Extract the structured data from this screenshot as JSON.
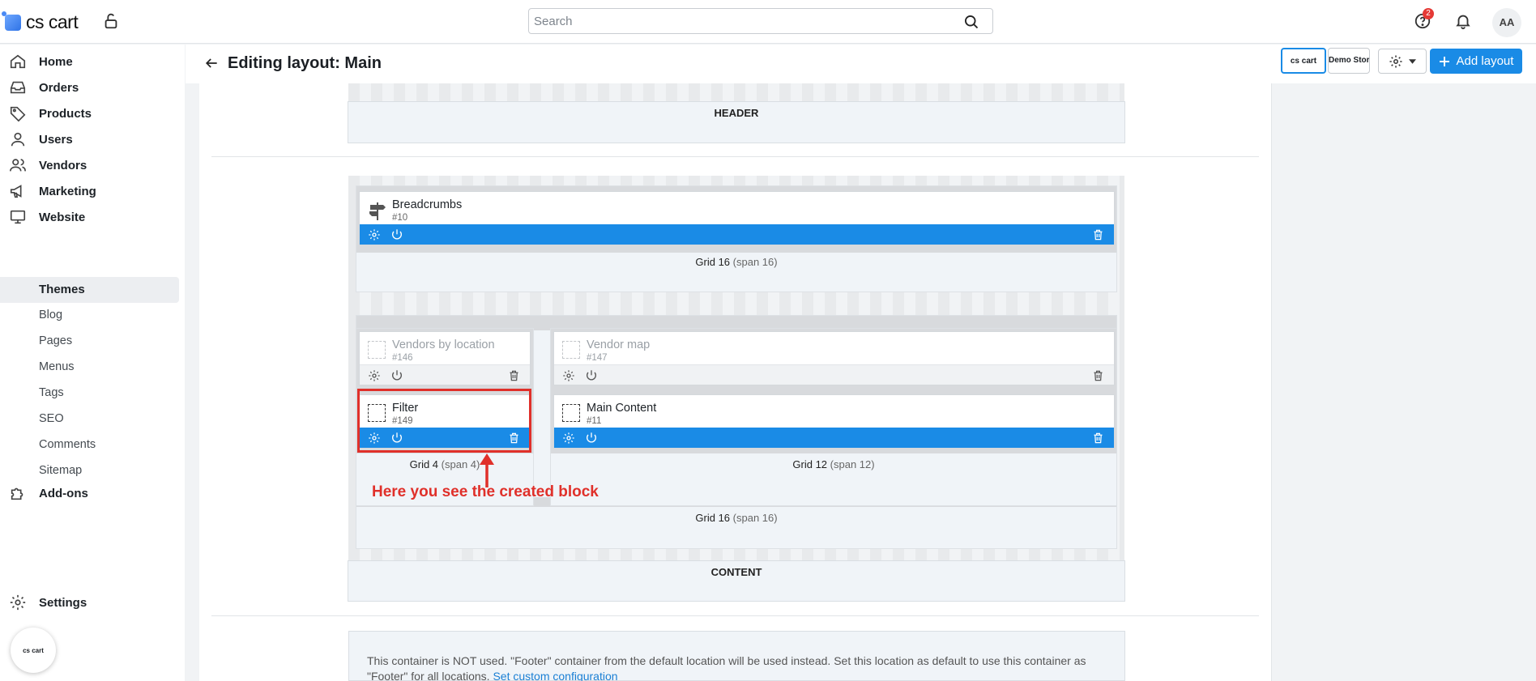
{
  "topbar": {
    "logo_text": "cs cart",
    "search_placeholder": "Search",
    "notifications_badge": "2",
    "avatar_initials": "AA"
  },
  "sidebar": {
    "items": [
      {
        "label": "Home",
        "icon": "home-icon"
      },
      {
        "label": "Orders",
        "icon": "inbox-icon"
      },
      {
        "label": "Products",
        "icon": "tag-icon"
      },
      {
        "label": "Users",
        "icon": "user-icon"
      },
      {
        "label": "Vendors",
        "icon": "vendors-icon"
      },
      {
        "label": "Marketing",
        "icon": "megaphone-icon"
      },
      {
        "label": "Website",
        "icon": "monitor-icon"
      }
    ],
    "sub_items": [
      "Themes",
      "Blog",
      "Pages",
      "Menus",
      "Tags",
      "SEO",
      "Comments",
      "Sitemap"
    ],
    "active_sub": "Themes",
    "addons": {
      "label": "Add-ons",
      "icon": "puzzle-icon"
    },
    "settings": {
      "label": "Settings",
      "icon": "gear-icon"
    },
    "floating_logo_text": "cs cart"
  },
  "header": {
    "title": "Editing layout: Main",
    "layout_thumbs": [
      "cs cart",
      "Demo Store"
    ],
    "add_layout_label": "Add layout"
  },
  "layout": {
    "header_container_label": "HEADER",
    "content_container_label": "CONTENT",
    "grids": {
      "top": {
        "name": "Grid 16",
        "span": "(span 16)"
      },
      "left": {
        "name": "Grid 4",
        "span": "(span 4)"
      },
      "right": {
        "name": "Grid 12",
        "span": "(span 12)"
      },
      "bottom": {
        "name": "Grid 16",
        "span": "(span 16)"
      }
    },
    "blocks": {
      "breadcrumbs": {
        "name": "Breadcrumbs",
        "id": "#10"
      },
      "vendors_by_location": {
        "name": "Vendors by location",
        "id": "#146"
      },
      "vendor_map": {
        "name": "Vendor map",
        "id": "#147"
      },
      "filter": {
        "name": "Filter",
        "id": "#149"
      },
      "main_content": {
        "name": "Main Content",
        "id": "#11"
      }
    },
    "annotation": "Here you see the created block",
    "footer_note": "This container is NOT used. \"Footer\" container from the default location will be used instead. Set this location as default to use this container as \"Footer\" for all locations.",
    "footer_link": "Set custom configuration"
  },
  "colors": {
    "accent": "#1a8be6",
    "annotation": "#e0302a",
    "badge": "#e53935"
  }
}
